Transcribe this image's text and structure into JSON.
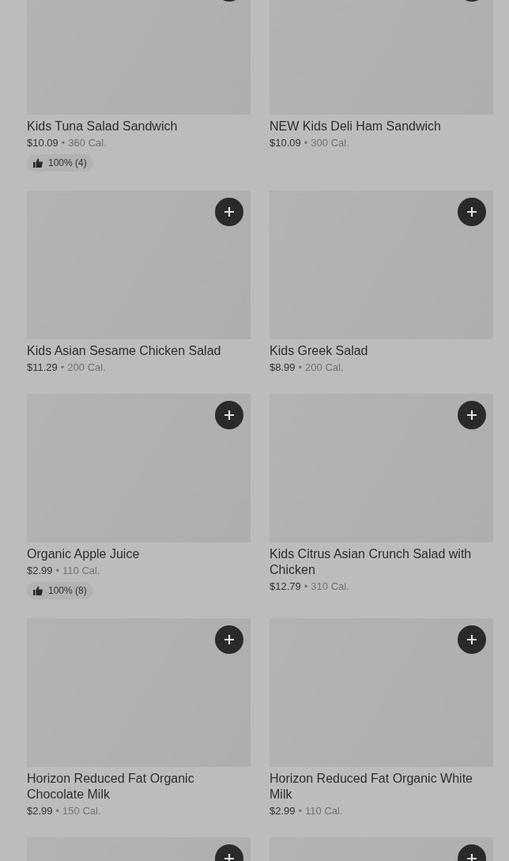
{
  "items": [
    {
      "kind": "item",
      "title": "Kids Tuna Salad Sandwich",
      "price": "$10.09",
      "separator": "•",
      "calories": "360 Cal.",
      "rating": "100% (4)"
    },
    {
      "kind": "item",
      "title": "NEW Kids Deli Ham Sandwich",
      "price": "$10.09",
      "separator": "•",
      "calories": "300 Cal."
    },
    {
      "kind": "item",
      "title": "Kids Asian Sesame Chicken Salad",
      "price": "$11.29",
      "separator": "•",
      "calories": "200 Cal."
    },
    {
      "kind": "item",
      "title": "Kids Greek Salad",
      "price": "$8.99",
      "separator": "•",
      "calories": "200 Cal."
    },
    {
      "kind": "item",
      "title": "Organic Apple Juice",
      "price": "$2.99",
      "separator": "•",
      "calories": "110 Cal.",
      "rating": "100% (8)"
    },
    {
      "kind": "item",
      "title": "Kids Citrus Asian Crunch Salad with Chicken",
      "price": "$12.79",
      "separator": "•",
      "calories": "310 Cal."
    },
    {
      "kind": "item",
      "title": "Horizon Reduced Fat Organic Chocolate Milk",
      "price": "$2.99",
      "separator": "•",
      "calories": "150 Cal."
    },
    {
      "kind": "item",
      "title": "Horizon Reduced Fat Organic White Milk",
      "price": "$2.99",
      "separator": "•",
      "calories": "110 Cal."
    },
    {
      "kind": "cut"
    },
    {
      "kind": "cut"
    }
  ]
}
